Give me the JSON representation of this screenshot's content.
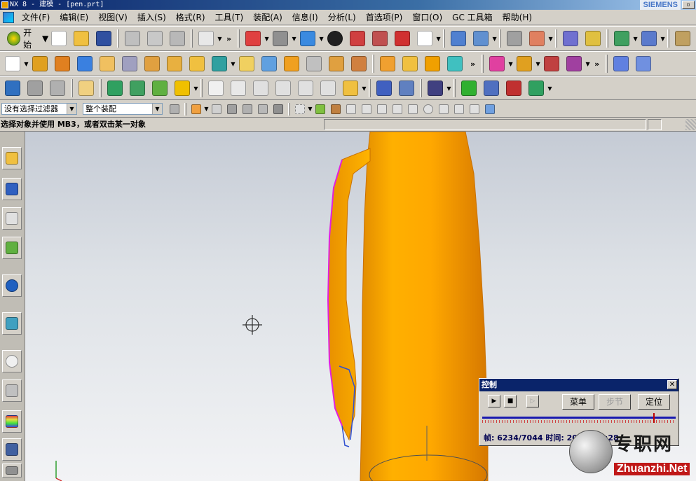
{
  "window": {
    "title": "NX 8 - 建模 - [pen.prt]",
    "brand": "SIEMENS"
  },
  "menu": {
    "items": [
      "文件(F)",
      "编辑(E)",
      "视图(V)",
      "插入(S)",
      "格式(R)",
      "工具(T)",
      "装配(A)",
      "信息(I)",
      "分析(L)",
      "首选项(P)",
      "窗口(O)",
      "GC 工具箱",
      "帮助(H)"
    ]
  },
  "toolbar": {
    "start_label": "开始",
    "more_glyph": "»"
  },
  "selection_bar": {
    "filter_value": "没有选择过滤器",
    "scope_value": "整个装配"
  },
  "cue_line": {
    "text": "选择对象并使用 MB3，或者双击某一对象"
  },
  "control_dialog": {
    "title": "控制",
    "menu_label": "菜单",
    "step_label": "步节",
    "position_label": "定位",
    "frame_label": "帧:",
    "frame_value": "6234/7044",
    "time_label": "时间:",
    "time_value": "20:46/23:28",
    "progress": 0.885
  },
  "watermark": {
    "cn": "专职网",
    "en": "Zhuanzhi.Net"
  },
  "colors": {
    "title_bg": "#0a246a",
    "part_orange": "#ffa500",
    "clip_magenta": "#e020e0",
    "clip_blue": "#3050d0"
  }
}
